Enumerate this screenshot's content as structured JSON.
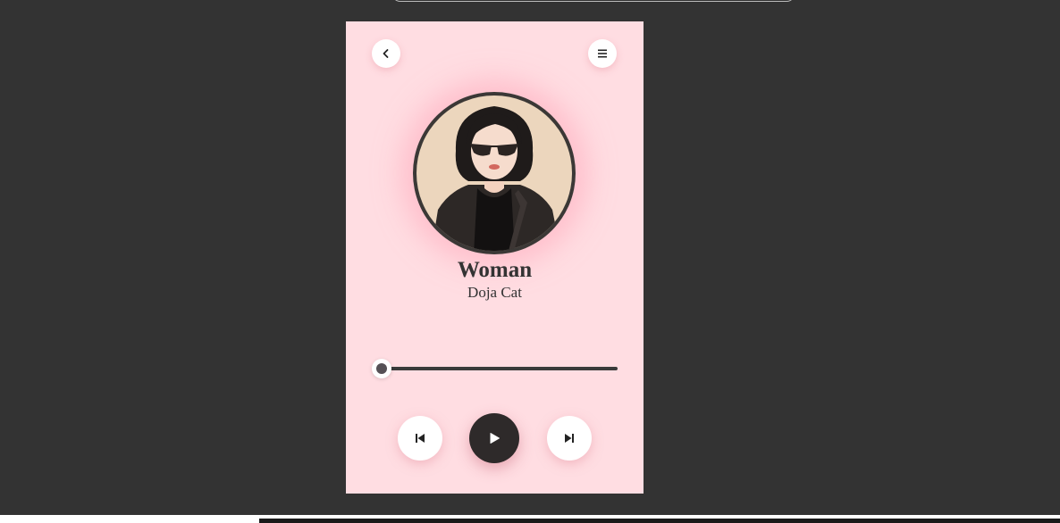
{
  "song": {
    "title": "Woman",
    "artist": "Doja Cat"
  },
  "player": {
    "progress_fraction": 0,
    "state": "paused"
  },
  "icons": {
    "back": "chevron-left-icon",
    "menu": "menu-icon",
    "previous": "skip-previous-icon",
    "play": "play-icon",
    "next": "skip-next-icon"
  },
  "colors": {
    "card_background": "#ffdde2",
    "page_background": "#333333",
    "accent_dark": "#2e2a2a",
    "text": "#333333"
  }
}
